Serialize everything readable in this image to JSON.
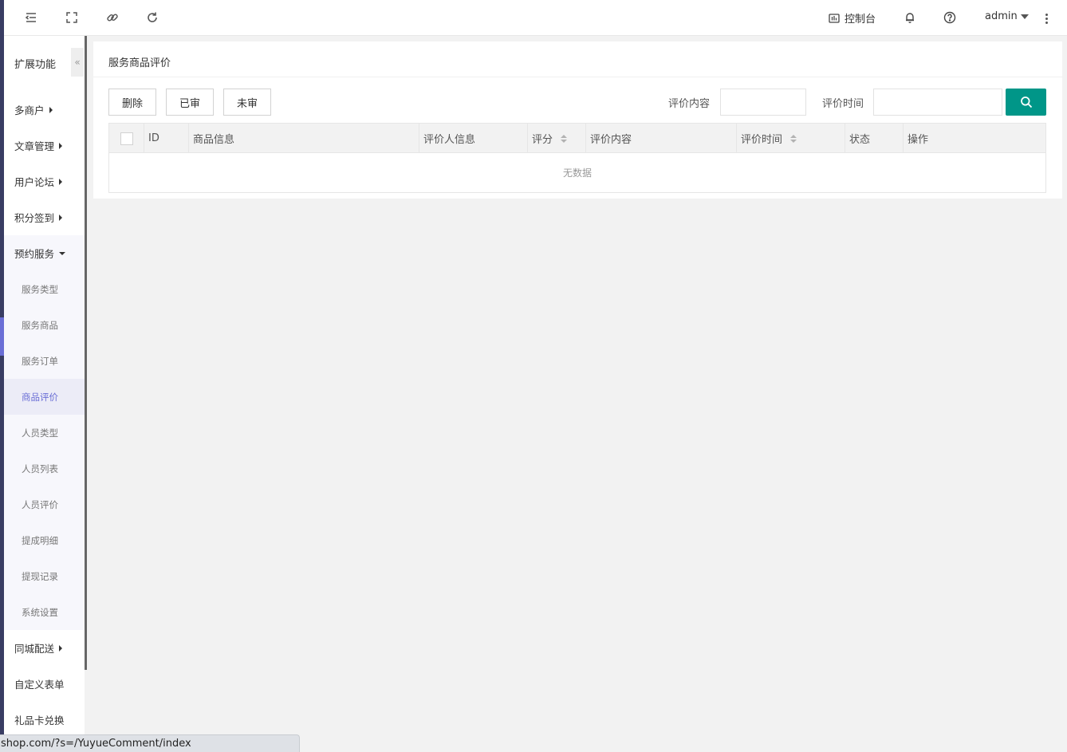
{
  "header": {
    "console_label": "控制台",
    "user_name": "admin"
  },
  "sidebar": {
    "title": "扩展功能",
    "collapse_glyph": "«",
    "items": [
      {
        "label": "多商户"
      },
      {
        "label": "文章管理"
      },
      {
        "label": "用户论坛"
      },
      {
        "label": "积分签到"
      },
      {
        "label": "预约服务"
      }
    ],
    "subitems": [
      {
        "label": "服务类型"
      },
      {
        "label": "服务商品"
      },
      {
        "label": "服务订单"
      },
      {
        "label": "商品评价"
      },
      {
        "label": "人员类型"
      },
      {
        "label": "人员列表"
      },
      {
        "label": "人员评价"
      },
      {
        "label": "提成明细"
      },
      {
        "label": "提现记录"
      },
      {
        "label": "系统设置"
      }
    ],
    "bottom_items": [
      {
        "label": "同城配送"
      },
      {
        "label": "自定义表单"
      },
      {
        "label": "礼品卡兑换"
      }
    ]
  },
  "main": {
    "title": "服务商品评价",
    "buttons": {
      "delete": "删除",
      "approved": "已审",
      "unapproved": "未审"
    },
    "filters": {
      "content_label": "评价内容",
      "content_value": "",
      "time_label": "评价时间",
      "time_value": ""
    },
    "table": {
      "columns": [
        "ID",
        "商品信息",
        "评价人信息",
        "评分",
        "评价内容",
        "评价时间",
        "状态",
        "操作"
      ],
      "empty_text": "无数据"
    }
  },
  "statusbar": {
    "url": "shop.com/?s=/YuyueComment/index"
  },
  "colors": {
    "accent": "#6b6fd6",
    "search_button": "#009688",
    "strip": "#393d63"
  }
}
